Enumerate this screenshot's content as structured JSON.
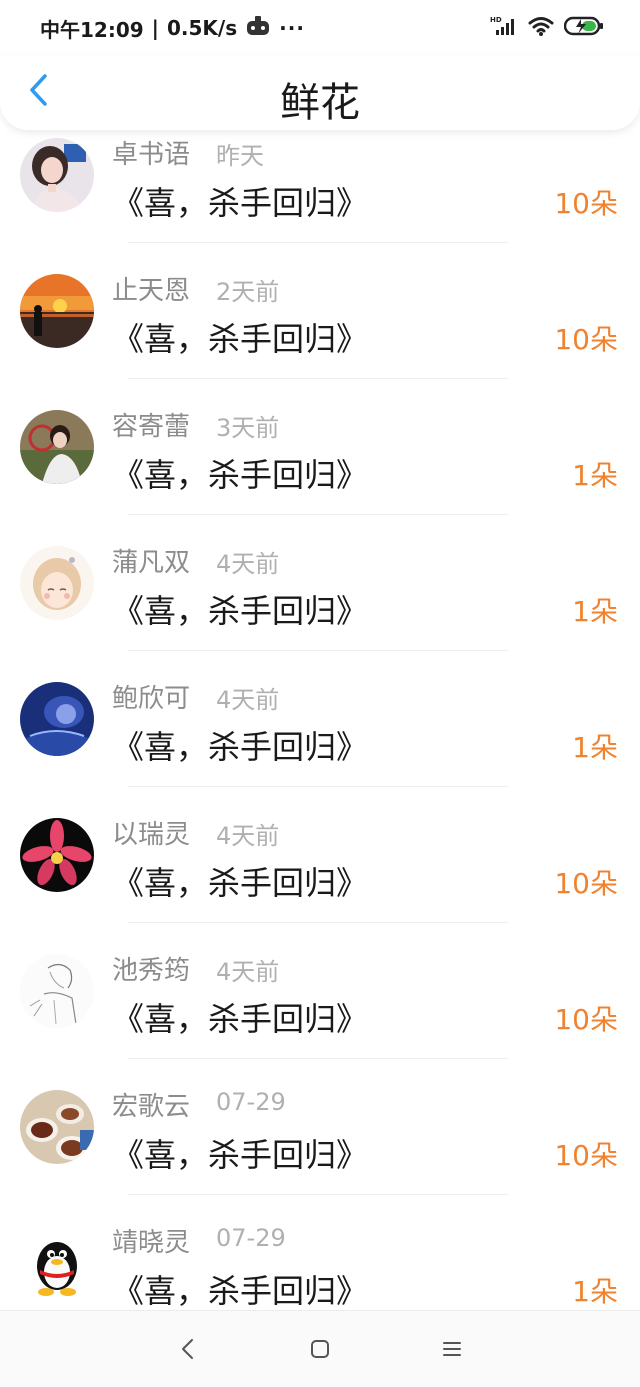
{
  "status_bar": {
    "time": "中午12:09",
    "separator": "|",
    "speed": "0.5K/s",
    "more": "···",
    "hd_label": "HD"
  },
  "header": {
    "title": "鲜花"
  },
  "items": [
    {
      "name": "卓书语",
      "time": "昨天",
      "book": "《喜，杀手回归》",
      "flowers": "10朵"
    },
    {
      "name": "止天恩",
      "time": "2天前",
      "book": "《喜，杀手回归》",
      "flowers": "10朵"
    },
    {
      "name": "容寄蕾",
      "time": "3天前",
      "book": "《喜，杀手回归》",
      "flowers": "1朵"
    },
    {
      "name": "蒲凡双",
      "time": "4天前",
      "book": "《喜，杀手回归》",
      "flowers": "1朵"
    },
    {
      "name": "鲍欣可",
      "time": "4天前",
      "book": "《喜，杀手回归》",
      "flowers": "1朵"
    },
    {
      "name": "以瑞灵",
      "time": "4天前",
      "book": "《喜，杀手回归》",
      "flowers": "10朵"
    },
    {
      "name": "池秀筠",
      "time": "4天前",
      "book": "《喜，杀手回归》",
      "flowers": "10朵"
    },
    {
      "name": "宏歌云",
      "time": "07-29",
      "book": "《喜，杀手回归》",
      "flowers": "10朵"
    },
    {
      "name": "靖晓灵",
      "time": "07-29",
      "book": "《喜，杀手回归》",
      "flowers": "1朵"
    }
  ],
  "colors": {
    "accent_blue": "#2f9bf0",
    "flower_orange": "#f0832f",
    "name_gray": "#8c8c8c",
    "time_gray": "#b0b0b0"
  },
  "icons": {
    "back": "chevron-left-icon",
    "nav_back": "nav-back-icon",
    "nav_home": "nav-home-icon",
    "nav_menu": "nav-menu-icon"
  }
}
